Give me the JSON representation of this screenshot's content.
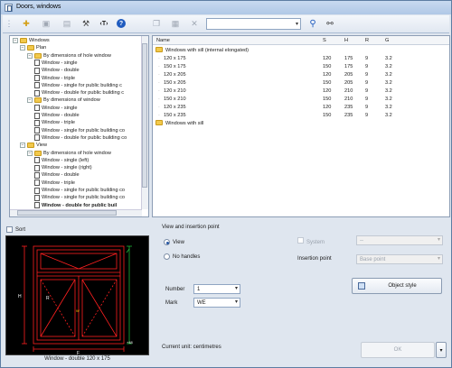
{
  "window": {
    "title": "Doors, windows"
  },
  "toolbar": {
    "search_value": "",
    "buttons": [
      {
        "name": "add-icon",
        "glyph": "✚"
      },
      {
        "name": "copy-icon",
        "glyph": "▣"
      },
      {
        "name": "paste-icon",
        "glyph": "▤"
      },
      {
        "name": "tools-icon",
        "glyph": "⚒"
      },
      {
        "name": "text-icon",
        "glyph": "T"
      },
      {
        "name": "help-icon",
        "glyph": "?"
      },
      {
        "name": "duplicate-icon",
        "glyph": "❐"
      },
      {
        "name": "clipboard-icon",
        "glyph": "▦"
      },
      {
        "name": "delete-icon",
        "glyph": "✕"
      },
      {
        "name": "search-icon",
        "glyph": "⚲"
      },
      {
        "name": "binoculars-icon",
        "glyph": "⚯"
      }
    ]
  },
  "tree": [
    {
      "label": "Windows",
      "level": 0,
      "type": "folder",
      "exp": "−"
    },
    {
      "label": "Plan",
      "level": 1,
      "type": "folder",
      "exp": "−"
    },
    {
      "label": "By dimensions of hole window",
      "level": 2,
      "type": "folder",
      "exp": "−"
    },
    {
      "label": "Window - single",
      "level": 3,
      "type": "doc"
    },
    {
      "label": "Window - double",
      "level": 3,
      "type": "doc"
    },
    {
      "label": "Window - triple",
      "level": 3,
      "type": "doc"
    },
    {
      "label": "Window - single for public building c",
      "level": 3,
      "type": "doc"
    },
    {
      "label": "Window - double for public building c",
      "level": 3,
      "type": "doc"
    },
    {
      "label": "By dimensions of window",
      "level": 2,
      "type": "folder",
      "exp": "−"
    },
    {
      "label": "Window - single",
      "level": 3,
      "type": "doc"
    },
    {
      "label": "Window - double",
      "level": 3,
      "type": "doc"
    },
    {
      "label": "Window - triple",
      "level": 3,
      "type": "doc"
    },
    {
      "label": "Window - single for public building co",
      "level": 3,
      "type": "doc"
    },
    {
      "label": "Window - double for public building co",
      "level": 3,
      "type": "doc"
    },
    {
      "label": "View",
      "level": 1,
      "type": "folder",
      "exp": "−"
    },
    {
      "label": "By dimensions of hole window",
      "level": 2,
      "type": "folder",
      "exp": "−"
    },
    {
      "label": "Window - single (left)",
      "level": 3,
      "type": "doc"
    },
    {
      "label": "Window - single (right)",
      "level": 3,
      "type": "doc"
    },
    {
      "label": "Window - double",
      "level": 3,
      "type": "doc"
    },
    {
      "label": "Window - triple",
      "level": 3,
      "type": "doc"
    },
    {
      "label": "Window - single for public building co",
      "level": 3,
      "type": "doc"
    },
    {
      "label": "Window - single for public building co",
      "level": 3,
      "type": "doc"
    },
    {
      "label": "Window - double for public buil",
      "level": 3,
      "type": "doc",
      "selected": true
    }
  ],
  "list": {
    "columns": [
      "Name",
      "S",
      "H",
      "R",
      "G"
    ],
    "group1": "Windows with sill (internal elongated)",
    "rows": [
      [
        "120 x 175",
        "120",
        "175",
        "9",
        "3.2"
      ],
      [
        "150 x 175",
        "150",
        "175",
        "9",
        "3.2"
      ],
      [
        "120 x 205",
        "120",
        "205",
        "9",
        "3.2"
      ],
      [
        "150 x 205",
        "150",
        "205",
        "9",
        "3.2"
      ],
      [
        "120 x 210",
        "120",
        "210",
        "9",
        "3.2"
      ],
      [
        "150 x 210",
        "150",
        "210",
        "9",
        "3.2"
      ],
      [
        "120 x 235",
        "120",
        "235",
        "9",
        "3.2"
      ],
      [
        "150 x 235",
        "150",
        "235",
        "9",
        "3.2"
      ]
    ],
    "group2": "Windows with sill"
  },
  "sort_label": "Sort",
  "preview": {
    "caption": "Window - double 120 x 175",
    "labels": {
      "r_marker": "R",
      "h_marker": "H",
      "f_marker": "F",
      "w_marker": "W",
      "dim_marker": "+48"
    }
  },
  "options": {
    "section_title": "View and insertion point",
    "view_label": "View",
    "no_handles_label": "No handles",
    "system_label": "System",
    "system_value": "--",
    "insertion_label": "Insertion point",
    "insertion_value": "Base point",
    "number_label": "Number",
    "number_value": "1",
    "mark_label": "Mark",
    "mark_value": "WE",
    "object_style_label": "Object style",
    "current_unit": "Current unit: centimetres",
    "ok_label": "OK"
  }
}
